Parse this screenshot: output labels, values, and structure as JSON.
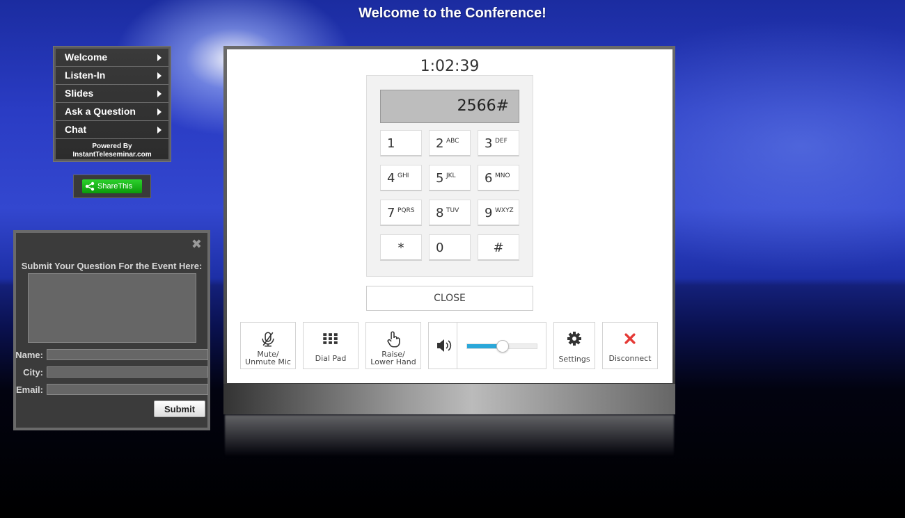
{
  "page": {
    "title": "Welcome to the Conference!"
  },
  "nav": {
    "items": [
      {
        "label": "Welcome"
      },
      {
        "label": "Listen-In"
      },
      {
        "label": "Slides"
      },
      {
        "label": "Ask a Question"
      },
      {
        "label": "Chat"
      }
    ],
    "powered_line1": "Powered By",
    "powered_line2": "InstantTeleseminar.com"
  },
  "share": {
    "label": "ShareThis",
    "icon": "share-icon",
    "color": "#19b319"
  },
  "question_form": {
    "title": "Submit Your Question For the Event Here:",
    "close_icon": "close-icon",
    "fields": {
      "name_label": "Name:",
      "city_label": "City:",
      "email_label": "Email:"
    },
    "submit_label": "Submit"
  },
  "phone": {
    "timer": "1:02:39",
    "display_value": "2566#",
    "keys": [
      {
        "digit": "1",
        "letters": ""
      },
      {
        "digit": "2",
        "letters": "ABC"
      },
      {
        "digit": "3",
        "letters": "DEF"
      },
      {
        "digit": "4",
        "letters": "GHI"
      },
      {
        "digit": "5",
        "letters": "JKL"
      },
      {
        "digit": "6",
        "letters": "MNO"
      },
      {
        "digit": "7",
        "letters": "PQRS"
      },
      {
        "digit": "8",
        "letters": "TUV"
      },
      {
        "digit": "9",
        "letters": "WXYZ"
      },
      {
        "digit": "*",
        "letters": ""
      },
      {
        "digit": "0",
        "letters": ""
      },
      {
        "digit": "#",
        "letters": ""
      }
    ],
    "close_label": "CLOSE",
    "controls": {
      "mute_line1": "Mute/",
      "mute_line2": "Unmute Mic",
      "dialpad": "Dial Pad",
      "raise_line1": "Raise/",
      "raise_line2": "Lower Hand",
      "settings": "Settings",
      "disconnect": "Disconnect"
    },
    "volume_level": 0.5,
    "accent_color": "#2aa7d9",
    "disconnect_color": "#e53935"
  }
}
